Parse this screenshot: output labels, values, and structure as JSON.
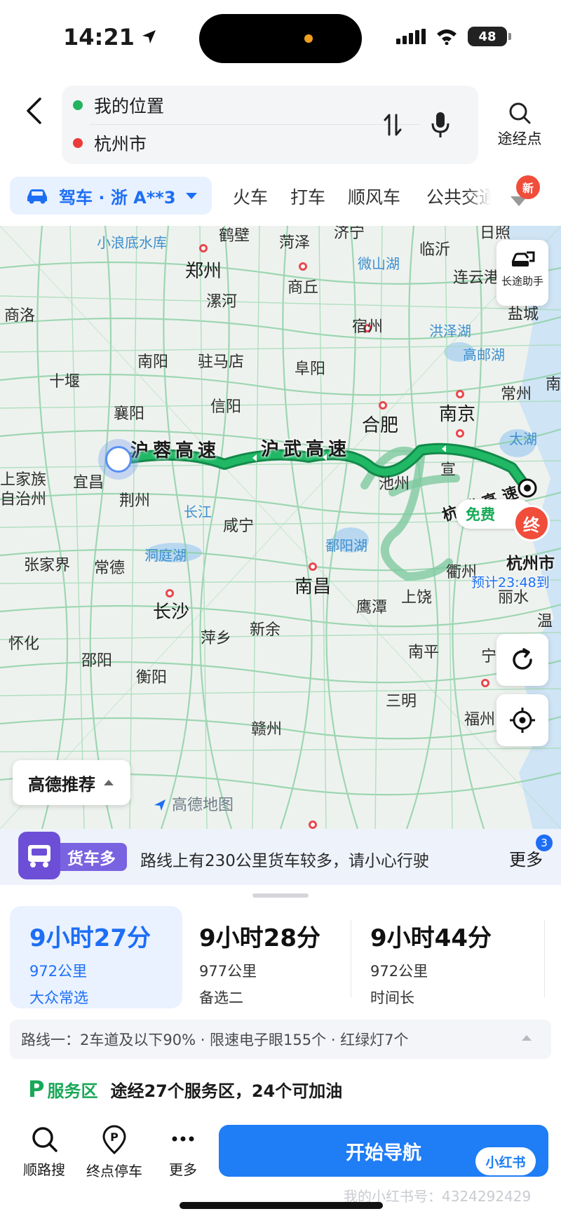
{
  "status_bar": {
    "time": "14:21",
    "battery": "48"
  },
  "search": {
    "origin": "我的位置",
    "destination": "杭州市",
    "waypoint_label": "途经点"
  },
  "modes": {
    "drive_label": "驾车 · 浙 A**3",
    "tabs": [
      "火车",
      "打车",
      "顺风车",
      "公共交通"
    ],
    "new_badge": "新"
  },
  "map": {
    "cities": [
      {
        "name": "鹤壁"
      },
      {
        "name": "菏泽"
      },
      {
        "name": "济宁"
      },
      {
        "name": "日照"
      },
      {
        "name": "小浪底水库"
      },
      {
        "name": "郑州"
      },
      {
        "name": "商丘"
      },
      {
        "name": "微山湖"
      },
      {
        "name": "临沂"
      },
      {
        "name": "连云港"
      },
      {
        "name": "商洛"
      },
      {
        "name": "漯河"
      },
      {
        "name": "宿州"
      },
      {
        "name": "洪泽湖"
      },
      {
        "name": "盐城"
      },
      {
        "name": "十堰"
      },
      {
        "name": "南阳"
      },
      {
        "name": "驻马店"
      },
      {
        "name": "阜阳"
      },
      {
        "name": "高邮湖"
      },
      {
        "name": "常州"
      },
      {
        "name": "襄阳"
      },
      {
        "name": "信阳"
      },
      {
        "name": "合肥"
      },
      {
        "name": "南京"
      },
      {
        "name": "太湖"
      },
      {
        "name": "宜昌"
      },
      {
        "name": "荆州"
      },
      {
        "name": "池州"
      },
      {
        "name": "宣"
      },
      {
        "name": "长江"
      },
      {
        "name": "咸宁"
      },
      {
        "name": "鄱阳湖"
      },
      {
        "name": "洞庭湖"
      },
      {
        "name": "张家界"
      },
      {
        "name": "常德"
      },
      {
        "name": "南昌"
      },
      {
        "name": "衢州"
      },
      {
        "name": "丽水"
      },
      {
        "name": "温"
      },
      {
        "name": "长沙"
      },
      {
        "name": "鹰潭"
      },
      {
        "name": "上饶"
      },
      {
        "name": "怀化"
      },
      {
        "name": "萍乡"
      },
      {
        "name": "新余"
      },
      {
        "name": "南平"
      },
      {
        "name": "邵阳"
      },
      {
        "name": "衡阳"
      },
      {
        "name": "三明"
      },
      {
        "name": "宁"
      },
      {
        "name": "赣州"
      },
      {
        "name": "福州"
      },
      {
        "name": "上家族"
      },
      {
        "name": "自治州"
      },
      {
        "name": "南"
      }
    ],
    "road_labels": [
      "沪蓉高速",
      "沪武高速",
      "杭瑞高速"
    ],
    "free_label": "免费",
    "end_label": "终",
    "destination_label": "杭州市",
    "eta": "预计23:48到",
    "long_trip_label": "长途助手",
    "recommend_label": "高德推荐",
    "map_watermark": "高德地图"
  },
  "notice": {
    "tag": "货车多",
    "text": "路线上有230公里货车较多，请小心行驶",
    "more": "更多",
    "count": "3"
  },
  "routes": [
    {
      "duration": "9小时27分",
      "distance": "972公里",
      "tag": "大众常选",
      "selected": true
    },
    {
      "duration": "9小时28分",
      "distance": "977公里",
      "tag": "备选二",
      "selected": false
    },
    {
      "duration": "9小时44分",
      "distance": "972公里",
      "tag": "时间长",
      "selected": false
    }
  ],
  "route_detail": "路线一：2车道及以下90% · 限速电子眼155个 · 红绿灯7个",
  "service_area": {
    "label": "服务区",
    "text": "途经27个服务区，24个可加油"
  },
  "footer": {
    "search_along": "顺路搜",
    "end_parking": "终点停车",
    "more": "更多",
    "start_nav": "开始导航",
    "badge": "小红书",
    "watermark": "我的小红书号：4324292429"
  },
  "colors": {
    "accent": "#1d6ef5",
    "route_green": "#1fae5f",
    "alert_red": "#f04d3b"
  }
}
